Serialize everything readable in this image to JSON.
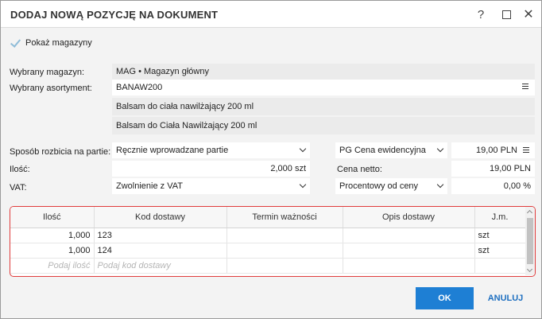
{
  "window": {
    "title": "DODAJ NOWĄ POZYCJĘ NA DOKUMENT",
    "help_icon": "?",
    "close_icon": "✕"
  },
  "show_warehouses": {
    "label": "Pokaż magazyny",
    "checked": true
  },
  "warehouse": {
    "label": "Wybrany magazyn:",
    "value": "MAG • Magazyn główny"
  },
  "assortment": {
    "label": "Wybrany asortyment:",
    "code": "BANAW200",
    "name": "Balsam do ciała nawilżający 200 ml",
    "full_name": "Balsam do Ciała Nawilżający 200 ml"
  },
  "batch_split": {
    "label": "Sposób rozbicia na partie:",
    "value": "Ręcznie wprowadzane partie"
  },
  "quantity": {
    "label": "Ilość:",
    "value": "2,000 szt"
  },
  "vat": {
    "label": "VAT:",
    "value": "Zwolnienie z VAT"
  },
  "price_type": {
    "value": "PG  Cena ewidencyjna",
    "amount": "19,00 PLN"
  },
  "net_price": {
    "label": "Cena netto:",
    "value": "19,00 PLN"
  },
  "discount": {
    "value": "Procentowy od ceny",
    "amount": "0,00 %"
  },
  "grid": {
    "columns": [
      "Ilość",
      "Kod dostawy",
      "Termin ważności",
      "Opis dostawy",
      "J.m."
    ],
    "rows": [
      {
        "qty": "1,000",
        "code": "123",
        "expiry": "",
        "desc": "",
        "unit": "szt"
      },
      {
        "qty": "1,000",
        "code": "124",
        "expiry": "",
        "desc": "",
        "unit": "szt"
      }
    ],
    "placeholder": {
      "qty": "Podaj ilość",
      "code": "Podaj kod dostawy"
    }
  },
  "buttons": {
    "ok": "OK",
    "cancel": "ANULUJ"
  },
  "colors": {
    "accent": "#1e7fd4",
    "grid_border": "#e03c3c"
  }
}
